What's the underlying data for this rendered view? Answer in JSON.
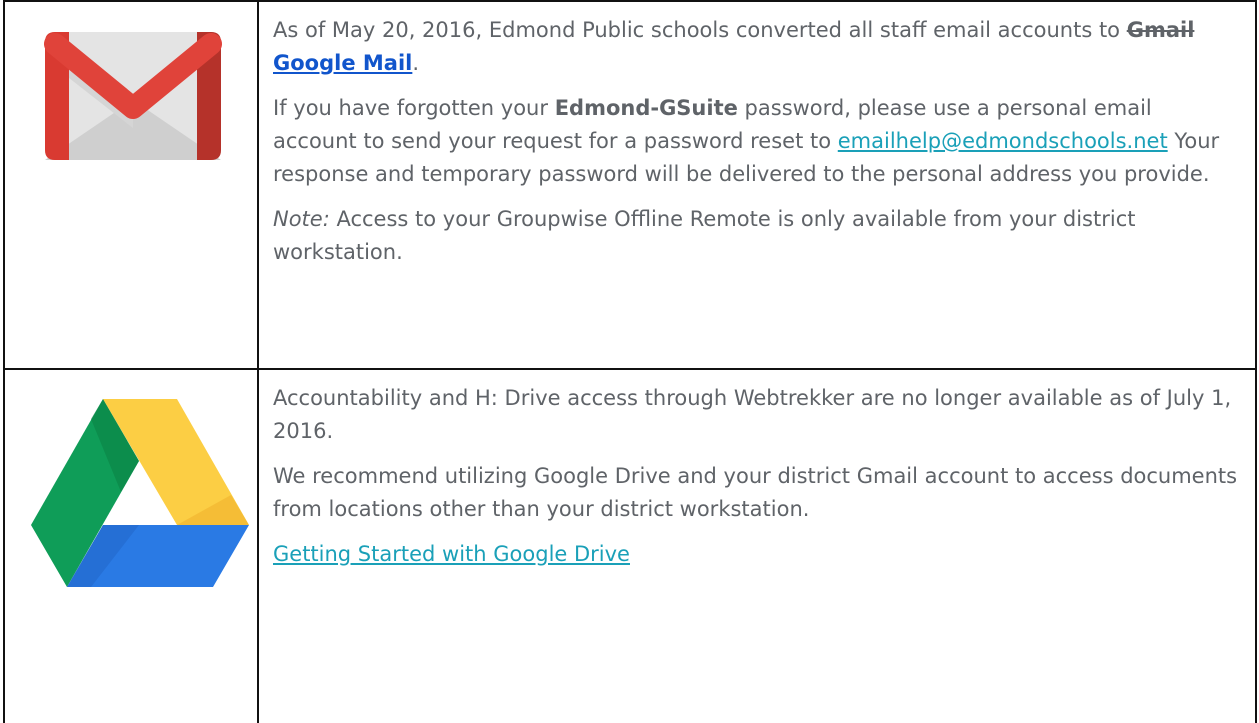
{
  "gmail": {
    "icon": "gmail-logo",
    "p1_before": "As of May 20, 2016,  Edmond Public schools converted all staff email accounts to ",
    "p1_strike": "Gmail",
    "p1_space": " ",
    "p1_link": "Google Mail",
    "p1_after": ".",
    "p2_before": "If you have forgotten your ",
    "p2_bold": "Edmond-GSuite",
    "p2_mid": " password,  please use a personal email account to send your request for a password reset to ",
    "p2_link": "emailhelp@edmondschools.net",
    "p2_after": "  Your response and temporary password will be delivered to the personal address you provide.",
    "p3_italic": "Note:",
    "p3_rest": " Access to your Groupwise Offline Remote is only available from your district workstation."
  },
  "drive": {
    "icon": "google-drive-logo",
    "p1": "Accountability and H: Drive access through Webtrekker are no longer available as of July 1, 2016.",
    "p2": "We recommend utilizing Google Drive and your district Gmail account to access documents from locations other than your district workstation.",
    "p3_link": "Getting Started with Google Drive"
  },
  "colors": {
    "text": "#5f6368",
    "link_primary": "#1155cc",
    "link_secondary": "#1aa0b8",
    "border": "#111111"
  }
}
